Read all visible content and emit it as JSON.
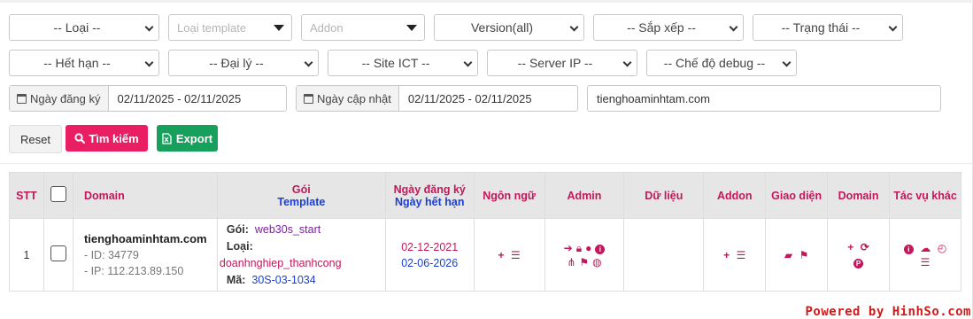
{
  "filters": {
    "loai": "-- Loại --",
    "loai_template_placeholder": "Loại template",
    "addon_placeholder": "Addon",
    "version": "Version(all)",
    "sap_xep": "-- Sắp xếp --",
    "trang_thai": "-- Trạng thái --",
    "het_han": "-- Hết hạn --",
    "dai_ly": "-- Đại lý --",
    "site_ict": "-- Site ICT --",
    "server_ip": "-- Server IP --",
    "che_do_debug": "-- Chế độ debug --",
    "ngay_dang_ky_label": "Ngày đăng ký",
    "ngay_dang_ky_value": "02/11/2025 - 02/11/2025",
    "ngay_cap_nhat_label": "Ngày cập nhật",
    "ngay_cap_nhat_value": "02/11/2025 - 02/11/2025",
    "domain_search_value": "tienghoaminhtam.com"
  },
  "actions": {
    "reset": "Reset",
    "search": "Tìm kiếm",
    "export": "Export"
  },
  "table": {
    "headers": {
      "stt": "STT",
      "domain": "Domain",
      "goi": "Gói",
      "template": "Template",
      "ngay_dang_ky": "Ngày đăng ký",
      "ngay_het_han": "Ngày hết hạn",
      "ngon_ngu": "Ngôn ngữ",
      "admin": "Admin",
      "du_lieu": "Dữ liệu",
      "addon": "Addon",
      "giao_dien": "Giao diện",
      "domain2": "Domain",
      "tac_vu_khac": "Tác vụ khác"
    },
    "rows": [
      {
        "stt": "1",
        "domain": "tienghoaminhtam.com",
        "id": "- ID: 34779",
        "ip": "- IP: 112.213.89.150",
        "goi_label": "Gói:",
        "goi_value": "web30s_start",
        "loai_label": "Loại:",
        "loai_value": "doanhnghiep_thanhcong",
        "ma_label": "Mã:",
        "ma_value": "30S-03-1034",
        "ngay_dang_ky": "02-12-2021",
        "ngay_het_han": "02-06-2026"
      }
    ]
  },
  "icons": {
    "ngon_ngu": [
      "plus-icon",
      "list-icon"
    ],
    "admin": [
      "sign-in-icon",
      "lock-icon",
      "user-icon",
      "info-icon",
      "sitemap-icon",
      "flag-icon",
      "comments-icon"
    ],
    "addon": [
      "plus-icon",
      "list-icon"
    ],
    "giao_dien": [
      "folder-icon",
      "flag-icon"
    ],
    "domain": [
      "plus-icon",
      "refresh-icon",
      "parking-icon"
    ],
    "tac_vu": [
      "info-icon",
      "cloud-icon",
      "clock-icon",
      "list-icon"
    ]
  },
  "colors": {
    "accent_pink": "#c2185b",
    "accent_blue": "#1a3fd6",
    "search_button": "#e91e63",
    "export_button": "#16a05c"
  },
  "watermark": "Powered by HinhSo.com"
}
